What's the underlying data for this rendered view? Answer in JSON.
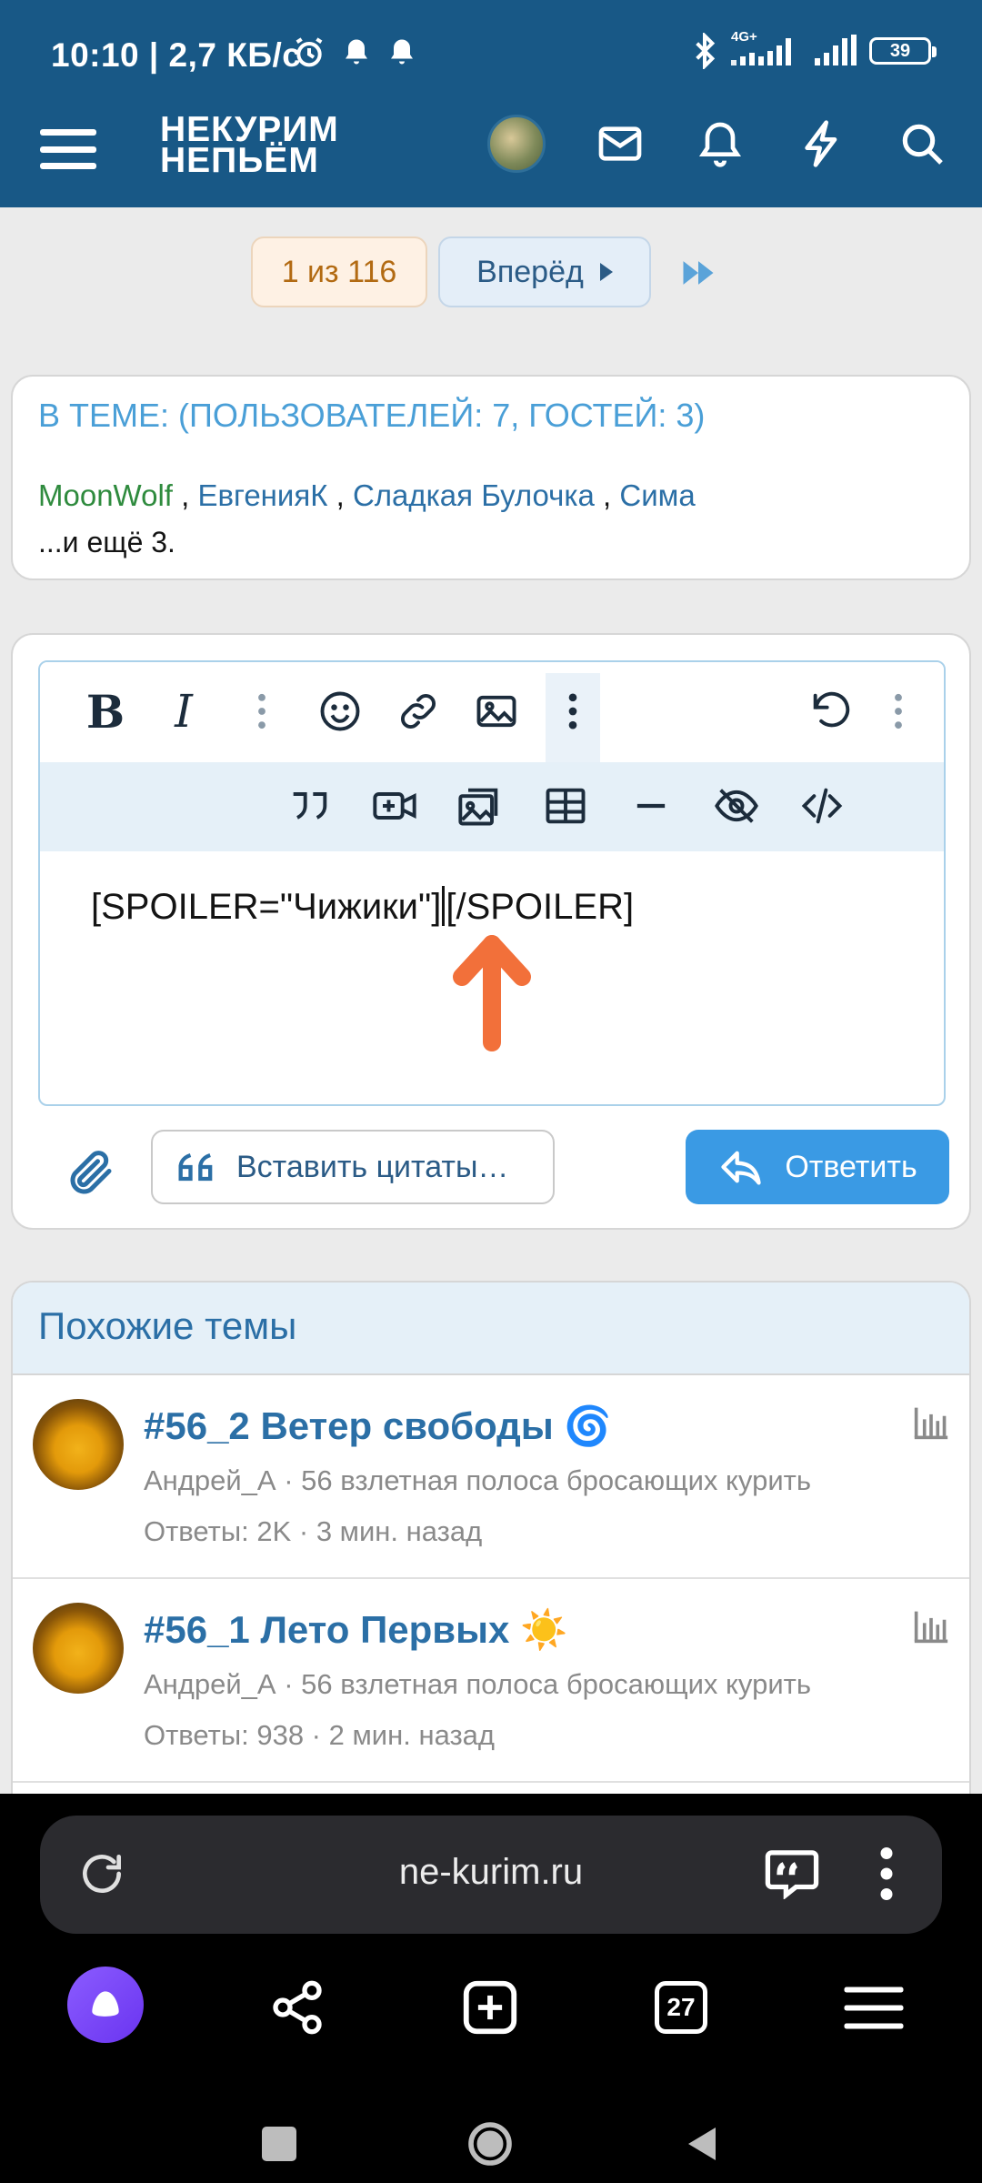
{
  "status_bar": {
    "time": "10:10",
    "speed": "| 2,7 КБ/с",
    "network": "4G+",
    "battery": "39"
  },
  "header": {
    "logo_line1": "НЕКУРИМ",
    "logo_line2": "НЕПЬЁМ",
    "icons": [
      "menu-icon",
      "avatar",
      "mail-icon",
      "bell-icon",
      "lightning-icon",
      "search-icon"
    ]
  },
  "pager": {
    "current": "1 из 116",
    "next": "Вперёд"
  },
  "online": {
    "title": "В ТЕМЕ: (ПОЛЬЗОВАТЕЛЕЙ: 7, ГОСТЕЙ: 3)",
    "users": [
      "MoonWolf",
      "ЕвгенияК",
      "Сладкая Булочка",
      "Сима"
    ],
    "separator": " , ",
    "more": "...и ещё 3."
  },
  "editor": {
    "toolbar_top": [
      "bold",
      "italic",
      "more",
      "emoji",
      "link",
      "image",
      "more",
      "undo",
      "more"
    ],
    "toolbar_bottom": [
      "quote",
      "media",
      "gallery",
      "table",
      "hr",
      "spoiler",
      "code"
    ],
    "bold_label": "B",
    "italic_label": "I",
    "content_before": "[SPOILER=\"Чижики\"]",
    "content_after": "[/SPOILER]",
    "attach_icon": "paperclip-icon",
    "insert_quotes": "Вставить цитаты…",
    "reply": "Ответить",
    "colors": {
      "accent": "#3a9ae4",
      "header": "#185886",
      "arrow": "#f2703a"
    }
  },
  "similar": {
    "title": "Похожие темы",
    "topics": [
      {
        "title": "#56_2 Ветер свободы 🌀",
        "author_forum": "Андрей_А · 56 взлетная полоса бросающих курить",
        "stats": "Ответы: 2K · 3 мин. назад"
      },
      {
        "title": "#56_1 Лето Первых ☀️",
        "author_forum": "Андрей_А · 56 взлетная полоса бросающих курить",
        "stats": "Ответы: 938 · 2 мин. назад"
      }
    ]
  },
  "browser": {
    "url": "ne-kurim.ru",
    "tabs": "27"
  }
}
